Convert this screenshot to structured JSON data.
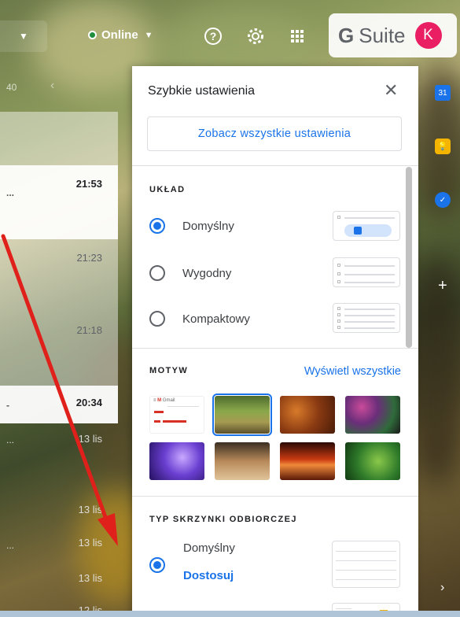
{
  "topbar": {
    "status_label": "Online",
    "product_g": "G",
    "product_name": "Suite",
    "avatar_letter": "K"
  },
  "pager": {
    "count_text": "40"
  },
  "mail_rows": [
    {
      "time": "21:53"
    },
    {
      "time": "21:23"
    },
    {
      "time": "21:18"
    },
    {
      "time": "20:34"
    },
    {
      "time": "13 lis"
    },
    {
      "time": "13 lis"
    },
    {
      "time": "13 lis"
    },
    {
      "time": "13 lis"
    },
    {
      "time": "12 lis"
    }
  ],
  "quick_settings": {
    "title": "Szybkie ustawienia",
    "see_all_label": "Zobacz wszystkie ustawienia",
    "layout": {
      "heading": "UKŁAD",
      "options": [
        {
          "label": "Domyślny",
          "selected": true
        },
        {
          "label": "Wygodny",
          "selected": false
        },
        {
          "label": "Kompaktowy",
          "selected": false
        }
      ]
    },
    "theme": {
      "heading": "MOTYW",
      "view_all_label": "Wyświetl wszystkie",
      "default_thumb_brand": "Gmail",
      "thumbs": [
        "default",
        "forest",
        "autumn-leaves",
        "bubbles",
        "jellyfish",
        "chess",
        "canyon",
        "chameleon"
      ],
      "selected": "forest"
    },
    "inbox_type": {
      "heading": "TYP SKRZYNKI ODBIORCZEJ",
      "options": [
        {
          "label": "Domyślny",
          "link": "Dostosuj",
          "selected": true
        }
      ]
    }
  },
  "colors": {
    "accent": "#1a73e8",
    "online": "#1e8e3e",
    "avatar": "#e91e63",
    "arrow": "#e0201b"
  }
}
